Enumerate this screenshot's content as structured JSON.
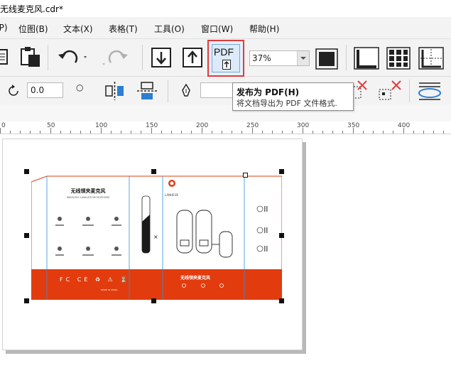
{
  "window": {
    "title": "无线麦克风.cdr*"
  },
  "menu": [
    {
      "label": "(P)",
      "name": "menu-layout-partial"
    },
    {
      "label": "位图(B)",
      "name": "menu-bitmaps"
    },
    {
      "label": "文本(X)",
      "name": "menu-text"
    },
    {
      "label": "表格(T)",
      "name": "menu-table"
    },
    {
      "label": "工具(O)",
      "name": "menu-tools"
    },
    {
      "label": "窗口(W)",
      "name": "menu-window"
    },
    {
      "label": "帮助(H)",
      "name": "menu-help"
    }
  ],
  "toolbar": {
    "zoom_value": "37%",
    "pdf_label": "PDF",
    "angle_value": "0.0"
  },
  "tooltip": {
    "title": "发布为 PDF(H)",
    "description": "将文档导出为 PDF 文件格式."
  },
  "ruler": {
    "labels": [
      "0",
      "50",
      "100",
      "150",
      "200",
      "250",
      "300",
      "350",
      "400"
    ]
  },
  "artwork": {
    "title": "无线领夹麦克风",
    "subtitle": "WIRELESS LAVALIER MICROPHONE",
    "brand": "LANHEUE",
    "band_title": "无线领夹麦克风",
    "band_marks": "FC CE ♻ ⚠ ⌛",
    "made_in": "MADE IN CHINA"
  },
  "colors": {
    "accent_red": "#e23c0e",
    "highlight_border": "#e23a3a",
    "guide_blue": "#2d8fe0"
  }
}
